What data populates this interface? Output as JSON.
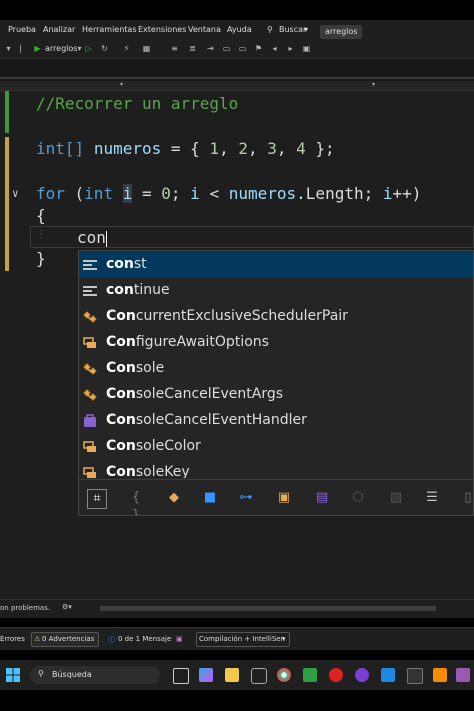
{
  "menu": {
    "items": [
      "Prueba",
      "Analizar",
      "Herramientas",
      "Extensiones",
      "Ventana",
      "Ayuda"
    ],
    "search_label": "Buscar",
    "project_tab": "arreglos"
  },
  "toolbar": {
    "target": "arreglos"
  },
  "editor": {
    "line1_comment": "//Recorrer un arreglo",
    "line2": {
      "type": "int[]",
      "name": "numeros",
      "eq": " = { ",
      "v1": "1",
      "v2": "2",
      "v3": "3",
      "v4": "4",
      "end": " };"
    },
    "line3": {
      "for": "for",
      "open": " (",
      "int": "int",
      "i": "i",
      "rest1": " = ",
      "zero": "0",
      "rest2": "; ",
      "i2": "i",
      "rest3": " < ",
      "numeros": "numeros",
      "dot": ".",
      "length": "Length",
      "rest4": "; ",
      "i3": "i",
      "rest5": "++)"
    },
    "brace_open": "{",
    "typed": "con",
    "brace_close": "}"
  },
  "completion": {
    "items": [
      {
        "match": "con",
        "rest": "st",
        "icon": "keyword-icon"
      },
      {
        "match": "con",
        "rest": "tinue",
        "icon": "keyword-icon"
      },
      {
        "match": "Con",
        "rest": "currentExclusiveSchedulerPair",
        "icon": "class-icon"
      },
      {
        "match": "Con",
        "rest": "figureAwaitOptions",
        "icon": "struct-icon"
      },
      {
        "match": "Con",
        "rest": "sole",
        "icon": "class-icon"
      },
      {
        "match": "Con",
        "rest": "soleCancelEventArgs",
        "icon": "class-icon"
      },
      {
        "match": "Con",
        "rest": "soleCancelEventHandler",
        "icon": "delegate-icon"
      },
      {
        "match": "Con",
        "rest": "soleColor",
        "icon": "enum-icon"
      },
      {
        "match": "Con",
        "rest": "soleKey",
        "icon": "enum-icon"
      }
    ],
    "filters": [
      "expand-icon",
      "namespace-icon",
      "class-filter-icon",
      "method-filter-icon",
      "interface-filter-icon",
      "struct-filter-icon",
      "delegate-filter-icon",
      "module-filter-icon",
      "snippet-filter-icon",
      "keyword-filter-icon",
      "more-filter-icon"
    ]
  },
  "status": {
    "problems": "on problemas.",
    "errors": "Errores",
    "warnings": "0 Advertencias",
    "messages": "0 de 1 Mensaje",
    "build_filter": "Compilación + IntelliSen"
  },
  "taskbar": {
    "search_placeholder": "Búsqueda"
  },
  "colors": {
    "accent_selection": "#04395e",
    "comment": "#57a64a",
    "keyword": "#569cd6"
  }
}
